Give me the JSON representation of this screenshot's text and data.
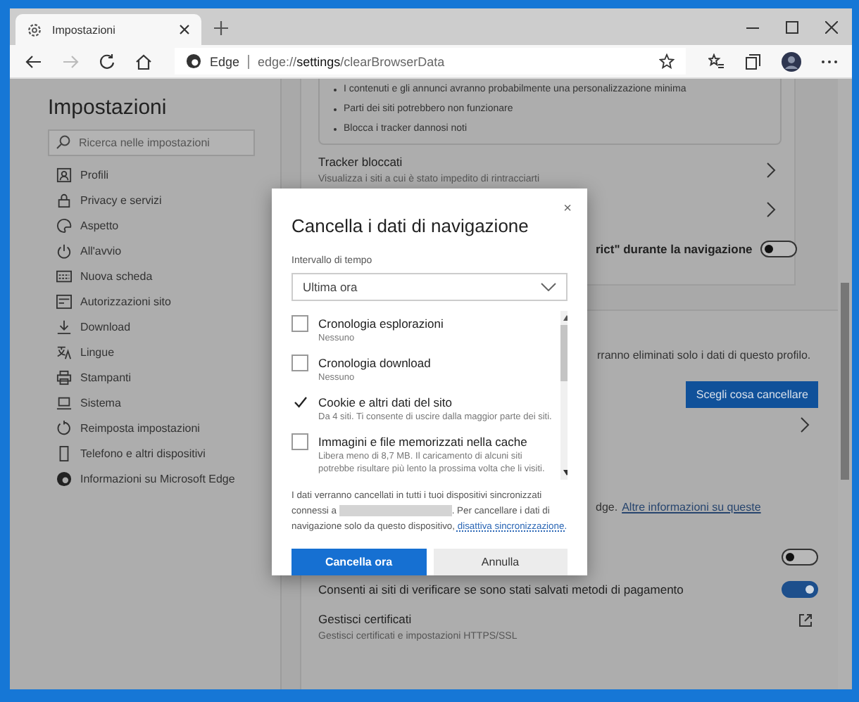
{
  "tab": {
    "title": "Impostazioni",
    "selected": true
  },
  "address": {
    "site_label": "Edge",
    "url_prefix": "edge://",
    "url_main": "settings",
    "url_suffix": "/clearBrowserData"
  },
  "sidebar": {
    "title": "Impostazioni",
    "search_placeholder": "Ricerca nelle impostazioni",
    "items": [
      {
        "label": "Profili"
      },
      {
        "label": "Privacy e servizi"
      },
      {
        "label": "Aspetto"
      },
      {
        "label": "All'avvio"
      },
      {
        "label": "Nuova scheda"
      },
      {
        "label": "Autorizzazioni sito"
      },
      {
        "label": "Download"
      },
      {
        "label": "Lingue"
      },
      {
        "label": "Stampanti"
      },
      {
        "label": "Sistema"
      },
      {
        "label": "Reimposta impostazioni"
      },
      {
        "label": "Telefono e altri dispositivi"
      },
      {
        "label": "Informazioni su Microsoft Edge"
      }
    ]
  },
  "content": {
    "bullets": [
      "I contenuti e gli annunci avranno probabilmente una personalizzazione minima",
      "Parti dei siti potrebbero non funzionare",
      "Blocca i tracker dannosi noti"
    ],
    "tracker": {
      "title": "Tracker bloccati",
      "subtitle": "Visualizza i siti a cui è stato impedito di rintracciarti"
    },
    "strict_row": {
      "label": "rict\" durante la navigazione",
      "on": false
    },
    "profile_note": "rranno eliminati solo i dati di questo profilo.",
    "choose_button": "Scegli cosa cancellare",
    "info_row": {
      "prefix": "dge.",
      "link": "Altre informazioni su queste"
    },
    "toggle_row": {
      "on": false
    },
    "payment_row": {
      "label": "Consenti ai siti di verificare se sono stati salvati metodi di pagamento",
      "on": true
    },
    "certs": {
      "title": "Gestisci certificati",
      "subtitle": "Gestisci certificati e impostazioni HTTPS/SSL"
    }
  },
  "dialog": {
    "title": "Cancella i dati di navigazione",
    "close": "×",
    "range_label": "Intervallo di tempo",
    "range_value": "Ultima ora",
    "items": [
      {
        "title": "Cronologia esplorazioni",
        "detail": "Nessuno",
        "checked": false
      },
      {
        "title": "Cronologia download",
        "detail": "Nessuno",
        "checked": false
      },
      {
        "title": "Cookie e altri dati del sito",
        "detail": "Da 4 siti. Ti consente di uscire dalla maggior parte dei siti.",
        "checked": true
      },
      {
        "title": "Immagini e file memorizzati nella cache",
        "detail": "Libera meno di 8,7 MB. Il caricamento di alcuni siti potrebbe risultare più lento la prossima volta che li visiti.",
        "checked": false
      }
    ],
    "note_before": "I dati verranno cancellati in tutti i tuoi dispositivi sincronizzati connessi a",
    "note_after": ". Per cancellare i dati di navigazione solo da questo dispositivo,",
    "note_link": "disattiva sincronizzazione.",
    "confirm": "Cancella ora",
    "cancel": "Annulla"
  }
}
